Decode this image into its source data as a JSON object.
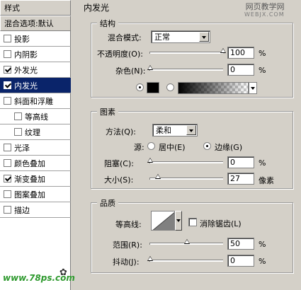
{
  "styles_panel": {
    "header": "样式",
    "blend_row": "混合选项:默认",
    "items": [
      {
        "label": "投影",
        "checked": false
      },
      {
        "label": "内阴影",
        "checked": false
      },
      {
        "label": "外发光",
        "checked": true
      },
      {
        "label": "内发光",
        "checked": true,
        "selected": true
      },
      {
        "label": "斜面和浮雕",
        "checked": false
      },
      {
        "label": "等高线",
        "checked": false,
        "sub": true
      },
      {
        "label": "纹理",
        "checked": false,
        "sub": true
      },
      {
        "label": "光泽",
        "checked": false
      },
      {
        "label": "颜色叠加",
        "checked": false
      },
      {
        "label": "渐变叠加",
        "checked": true
      },
      {
        "label": "图案叠加",
        "checked": false
      },
      {
        "label": "描边",
        "checked": false
      }
    ]
  },
  "panel_title": "内发光",
  "watermark": {
    "line1": "网页教学网",
    "line2": "WEBJX.COM"
  },
  "structure": {
    "title": "结构",
    "blend_mode_label": "混合模式:",
    "blend_mode_value": "正常",
    "opacity_label": "不透明度(O):",
    "opacity_value": "100",
    "opacity_unit": "%",
    "opacity_level": 1.0,
    "noise_label": "杂色(N):",
    "noise_value": "0",
    "noise_unit": "%",
    "noise_level": 0.0
  },
  "elements": {
    "title": "图素",
    "method_label": "方法(Q):",
    "method_value": "柔和",
    "source_label": "源:",
    "source_center_label": "居中(E)",
    "source_edge_label": "边缘(G)",
    "choke_label": "阻塞(C):",
    "choke_value": "0",
    "choke_unit": "%",
    "choke_level": 0.0,
    "size_label": "大小(S):",
    "size_value": "27",
    "size_unit": "像素",
    "size_level": 0.108
  },
  "quality": {
    "title": "品质",
    "contour_label": "等高线:",
    "antialias_label": "消除锯齿(L)",
    "range_label": "范围(R):",
    "range_value": "50",
    "range_unit": "%",
    "range_level": 0.5,
    "jitter_label": "抖动(J):",
    "jitter_value": "0",
    "jitter_unit": "%",
    "jitter_level": 0.0
  },
  "logo": "www.78ps.com",
  "colors": {
    "selection": "#0a246a",
    "panel": "#d4d0c8",
    "logo": "#2f9a2f"
  }
}
